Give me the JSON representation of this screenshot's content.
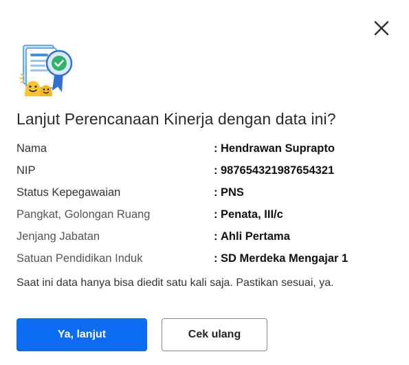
{
  "dialog": {
    "title": "Lanjut Perencanaan Kinerja dengan data ini?",
    "close_icon": "close-icon",
    "illustration_icon": "document-verified-illustration",
    "separator": ":",
    "rows": [
      {
        "label": "Nama",
        "value": "Hendrawan Suprapto"
      },
      {
        "label": "NIP",
        "value": "987654321987654321"
      },
      {
        "label": "Status Kepegawaian",
        "value": "PNS"
      },
      {
        "label": "Pangkat, Golongan Ruang",
        "value": "Penata, III/c"
      },
      {
        "label": "Jenjang Jabatan",
        "value": "Ahli Pertama"
      },
      {
        "label": "Satuan Pendidikan Induk",
        "value": "SD Merdeka Mengajar 1"
      }
    ],
    "note": "Saat ini data hanya bisa diedit satu kali saja. Pastikan sesuai, ya.",
    "primary_button": "Ya, lanjut",
    "secondary_button": "Cek ulang",
    "colors": {
      "primary": "#0b6cf2",
      "illustration_blue": "#3d8ff0",
      "illustration_yellow": "#f7c531",
      "check_green": "#2fb56a"
    }
  }
}
